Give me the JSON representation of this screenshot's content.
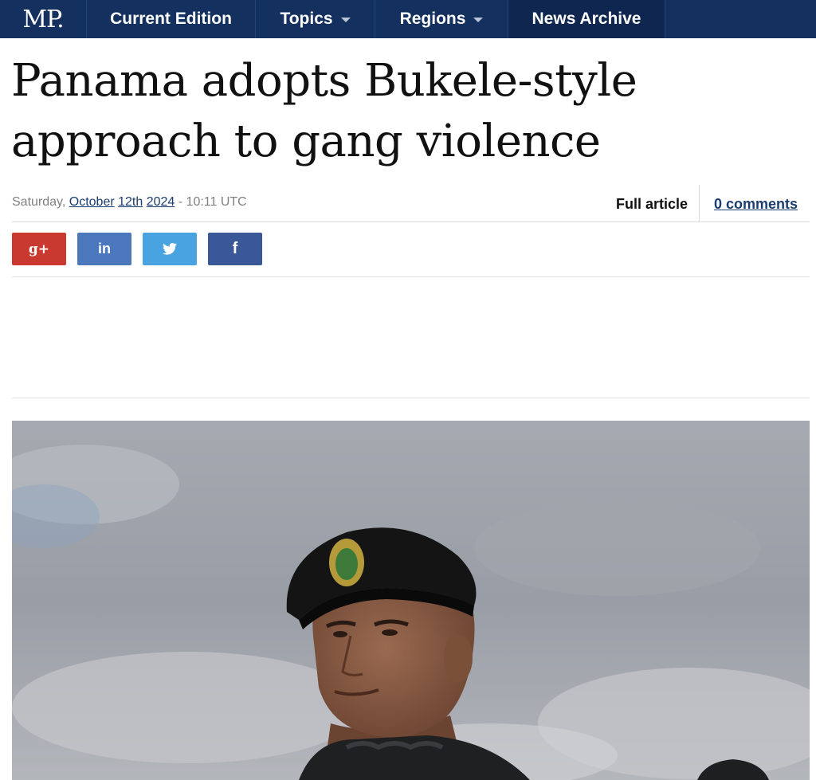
{
  "nav": {
    "logo": "MP.",
    "items": [
      {
        "label": "Current Edition"
      },
      {
        "label": "Topics"
      },
      {
        "label": "Regions"
      },
      {
        "label": "News Archive"
      }
    ]
  },
  "article": {
    "headline": "Panama adopts Bukele-style approach to gang violence",
    "date": {
      "weekday": "Saturday,",
      "month": "October",
      "day": "12th",
      "year": "2024",
      "time": "- 10:11 UTC"
    },
    "full_article_label": "Full article",
    "comments_label": "0 comments"
  },
  "share": {
    "google_glyph": "g+",
    "linkedin_glyph": "in",
    "facebook_glyph": "f"
  },
  "colors": {
    "nav_bg": "#14305f",
    "link": "#1b3c70",
    "google": "#c9392f",
    "linkedin": "#4b78bd",
    "twitter": "#4aa3e1",
    "facebook": "#3a5898"
  },
  "hero_image": {
    "subject_icon": "soldier-photo"
  }
}
